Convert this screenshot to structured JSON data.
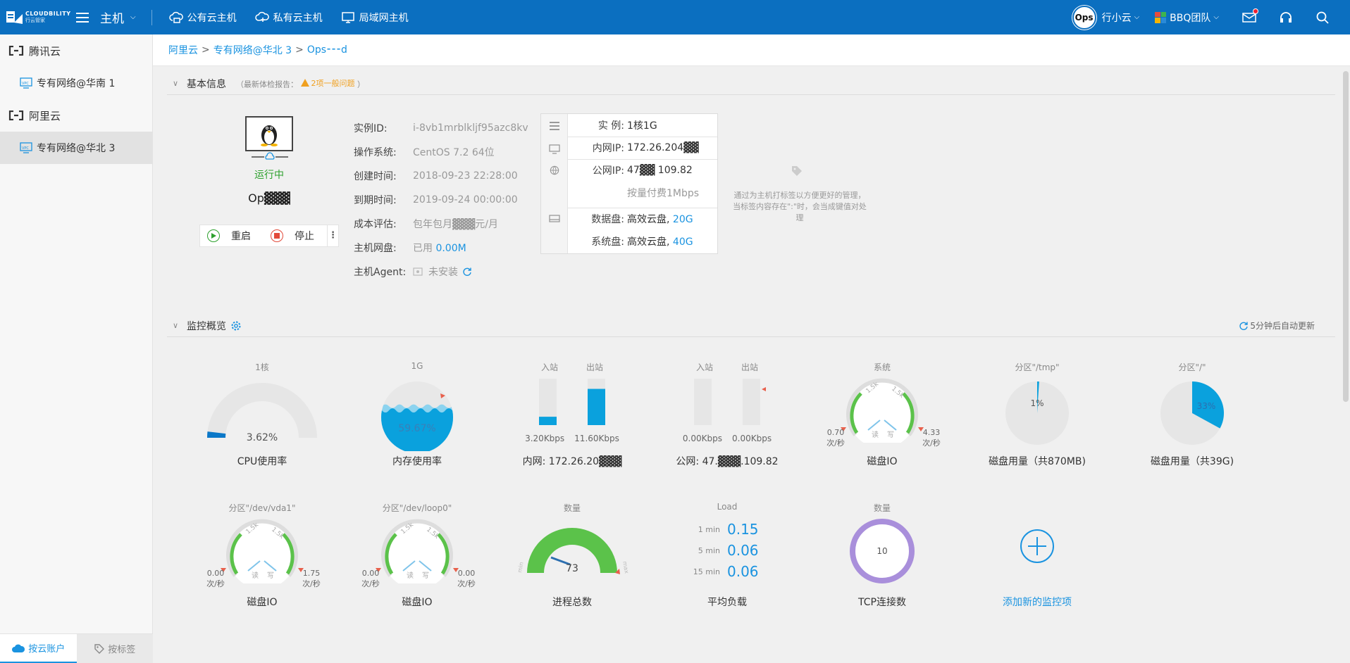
{
  "brand": {
    "name": "CLOUDBILITY",
    "sub": "行云管家"
  },
  "topbar": {
    "title": "主机",
    "nav": [
      {
        "label": "公有云主机",
        "icon": "cloud-host-icon"
      },
      {
        "label": "私有云主机",
        "icon": "private-cloud-icon"
      },
      {
        "label": "局域网主机",
        "icon": "monitor-icon"
      }
    ],
    "avatar": "Ops",
    "user": "行小云",
    "team": "BBQ团队"
  },
  "sidebar": {
    "groups": [
      {
        "label": "腾讯云",
        "items": [
          {
            "label": "专有网络@华南 1",
            "active": false
          }
        ]
      },
      {
        "label": "阿里云",
        "items": [
          {
            "label": "专有网络@华北 3",
            "active": true
          }
        ]
      }
    ],
    "bottom_tabs": [
      {
        "label": "按云账户",
        "active": true
      },
      {
        "label": "按标签",
        "active": false
      }
    ]
  },
  "breadcrumb": [
    "阿里云",
    "专有网络@华北 3",
    "Ops⁃⁃⁃d"
  ],
  "basic_info": {
    "title": "基本信息",
    "report_prefix": "（最新体检报告：",
    "report_link": "2项一般问题",
    "report_suffix": "）",
    "status": "运行中",
    "host_name": "Op▓▓▓",
    "actions": {
      "restart": "重启",
      "stop": "停止",
      "more": "⋮"
    },
    "fields": [
      {
        "k": "实例ID:",
        "v": "i-8vb1mrblkljf95azc8kv"
      },
      {
        "k": "操作系统:",
        "v": "CentOS 7.2 64位"
      },
      {
        "k": "创建时间:",
        "v": "2018-09-23 22:28:00"
      },
      {
        "k": "到期时间:",
        "v": "2019-09-24 00:00:00"
      },
      {
        "k": "成本评估:",
        "v": "包年包月▓▓▓元/月"
      },
      {
        "k": "主机网盘:",
        "v": "已用",
        "v2": "0.00M"
      },
      {
        "k": "主机Agent:",
        "v": "未安装"
      }
    ],
    "spec": {
      "instance_k": "实 例:",
      "instance_v": "1核1G",
      "private_ip_k": "内网IP:",
      "private_ip_v": "172.26.204▓▓",
      "public_ip_k": "公网IP:",
      "public_ip_v": "47▓▓ 109.82",
      "billing": "按量付费1Mbps",
      "data_disk_k": "数据盘:",
      "data_disk_v": "高效云盘,",
      "data_disk_size": "20G",
      "sys_disk_k": "系统盘:",
      "sys_disk_v": "高效云盘,",
      "sys_disk_size": "40G"
    },
    "tag_hint": "通过为主机打标签以方便更好的管理，当标签内容存在\":\"时，会当成键值对处理"
  },
  "monitor": {
    "title": "监控概览",
    "refresh": "5分钟后自动更新",
    "cpu": {
      "label": "1核",
      "value": "3.62%",
      "title": "CPU使用率",
      "percent": 3.62
    },
    "mem": {
      "label": "1G",
      "value": "59.67%",
      "title": "内存使用率",
      "percent": 59.67
    },
    "net_private": {
      "in_label": "入站",
      "out_label": "出站",
      "in_value": "3.20Kbps",
      "out_value": "11.60Kbps",
      "in_fill": 0.18,
      "out_fill": 0.78,
      "title": "内网:  172.26.20▓▓▓"
    },
    "net_public": {
      "in_label": "入站",
      "out_label": "出站",
      "in_value": "0.00Kbps",
      "out_value": "0.00Kbps",
      "in_fill": 0,
      "out_fill": 0,
      "title": "公网:  47.▓▓▓.109.82"
    },
    "sys_io": {
      "label": "系统",
      "read": "0.70",
      "write": "4.33",
      "unit": "次/秒",
      "title": "磁盘IO",
      "read_lbl": "读",
      "write_lbl": "写",
      "t1": "1.5k",
      "t2": "1.5k"
    },
    "disk_tmp": {
      "label": "分区\"/tmp\"",
      "value": "1%",
      "title": "磁盘用量（共870MB)",
      "percent": 1
    },
    "disk_root": {
      "label": "分区\"/\"",
      "value": "33%",
      "title": "磁盘用量（共39G)",
      "percent": 33
    },
    "io_vda1": {
      "label": "分区\"/dev/vda1\"",
      "read": "0.00",
      "write": "1.75",
      "unit": "次/秒",
      "title": "磁盘IO",
      "read_lbl": "读",
      "write_lbl": "写",
      "t1": "1.5k",
      "t2": "1.5k"
    },
    "io_loop0": {
      "label": "分区\"/dev/loop0\"",
      "read": "0.00",
      "write": "0.00",
      "unit": "次/秒",
      "title": "磁盘IO",
      "read_lbl": "读",
      "write_lbl": "写",
      "t1": "1.5k",
      "t2": "1.5k"
    },
    "procs": {
      "label": "数量",
      "value": "73",
      "title": "进程总数",
      "min": "min",
      "max": "max"
    },
    "load": {
      "label": "Load",
      "rows": [
        {
          "k": "1 min",
          "v": "0.15"
        },
        {
          "k": "5 min",
          "v": "0.06"
        },
        {
          "k": "15 min",
          "v": "0.06"
        }
      ],
      "title": "平均负载"
    },
    "tcp": {
      "label": "数量",
      "value": "10",
      "title": "TCP连接数"
    },
    "add": {
      "title": "添加新的监控项"
    }
  },
  "colors": {
    "primary": "#0b6fc0",
    "link": "#1a93e0",
    "green": "#2ca02c",
    "warn": "#f0a020",
    "gauge_gray": "#e6e6e6",
    "cpu_blue": "#0b78c8",
    "mem_blue": "#0aa1dd",
    "proc_green": "#5bc24a",
    "tcp_purple": "#a98fdb"
  }
}
